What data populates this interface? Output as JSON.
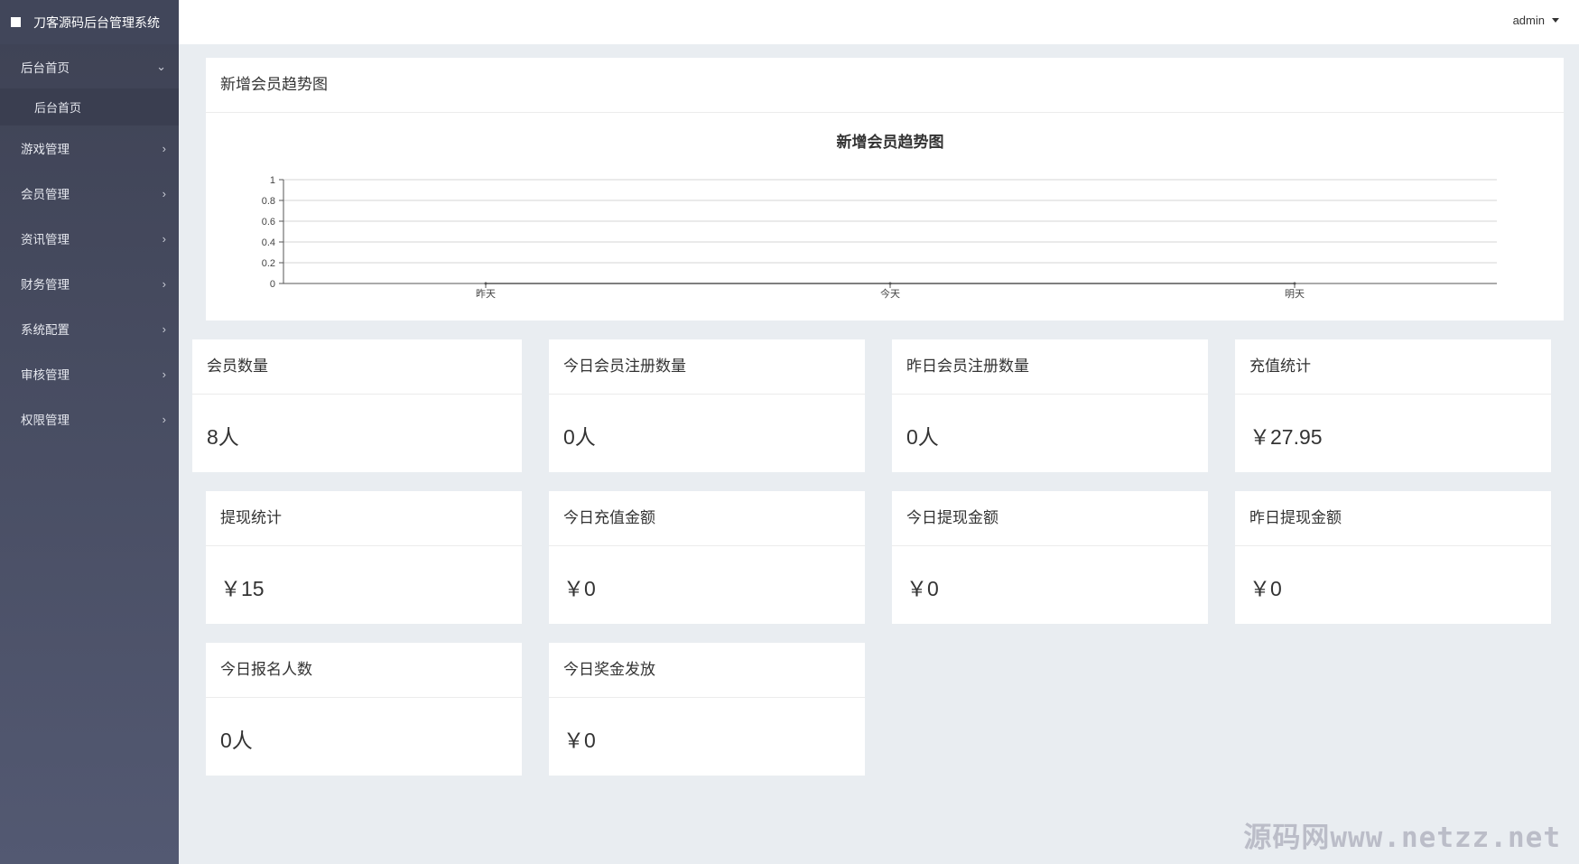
{
  "app": {
    "title": "刀客源码后台管理系统"
  },
  "header": {
    "user": "admin"
  },
  "sidebar": {
    "items": [
      {
        "label": "后台首页",
        "open": true
      },
      {
        "label": "游戏管理"
      },
      {
        "label": "会员管理"
      },
      {
        "label": "资讯管理"
      },
      {
        "label": "财务管理"
      },
      {
        "label": "系统配置"
      },
      {
        "label": "审核管理"
      },
      {
        "label": "权限管理"
      }
    ],
    "sub_item": "后台首页"
  },
  "panel": {
    "title": "新增会员趋势图"
  },
  "chart_data": {
    "type": "line",
    "title": "新增会员趋势图",
    "categories": [
      "昨天",
      "今天",
      "明天"
    ],
    "series": [
      {
        "values": [
          0,
          0,
          0
        ]
      }
    ],
    "yticks": [
      "0",
      "0.2",
      "0.4",
      "0.6",
      "0.8",
      "1"
    ],
    "ylim": [
      0,
      1
    ],
    "grid": true,
    "xlabel": "",
    "ylabel": ""
  },
  "cards": [
    {
      "title": "会员数量",
      "value": "8人"
    },
    {
      "title": "今日会员注册数量",
      "value": "0人"
    },
    {
      "title": "昨日会员注册数量",
      "value": "0人"
    },
    {
      "title": "充值统计",
      "value": "￥27.95"
    },
    {
      "title": "提现统计",
      "value": "￥15"
    },
    {
      "title": "今日充值金额",
      "value": "￥0"
    },
    {
      "title": "今日提现金额",
      "value": "￥0"
    },
    {
      "title": "昨日提现金额",
      "value": "￥0"
    },
    {
      "title": "今日报名人数",
      "value": "0人"
    },
    {
      "title": "今日奖金发放",
      "value": "￥0"
    }
  ],
  "watermark": "源码网www.netzz.net"
}
